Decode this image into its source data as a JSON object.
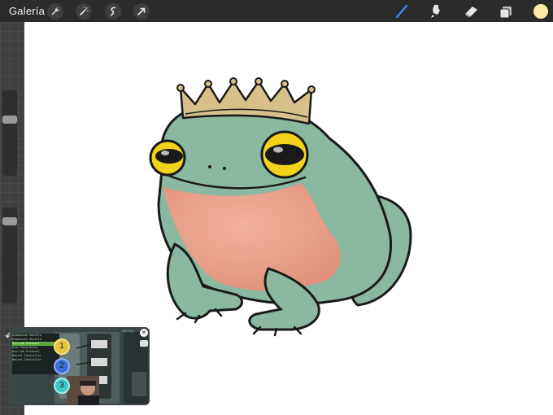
{
  "toolbar": {
    "gallery_label": "Galería",
    "left_tools": [
      "wrench-icon",
      "magic-wand-icon",
      "selection-icon",
      "transform-arrow-icon"
    ],
    "right_tools": [
      "brush-icon",
      "smudge-icon",
      "eraser-icon",
      "layers-icon"
    ],
    "active_tool": "brush-icon",
    "active_color": "#fce9a4",
    "accent_color": "#3a8ef5"
  },
  "sidebar": {
    "brush_size_label": "",
    "opacity_label": "",
    "undo_icon": "undo-arrow-icon"
  },
  "canvas": {
    "subject": "frog-with-crown-illustration"
  },
  "pip": {
    "list_items": [
      "Dimension Shuttle",
      "Dimension Shuttle",
      "Bio-Lab Protocol",
      "Scan Generation",
      "Bio-Lab Protocol",
      "Neural Controller",
      "Neural Controller"
    ],
    "highlight_index": 2,
    "steps": [
      "1",
      "2",
      "3"
    ],
    "title_label": "http://d.ly"
  }
}
